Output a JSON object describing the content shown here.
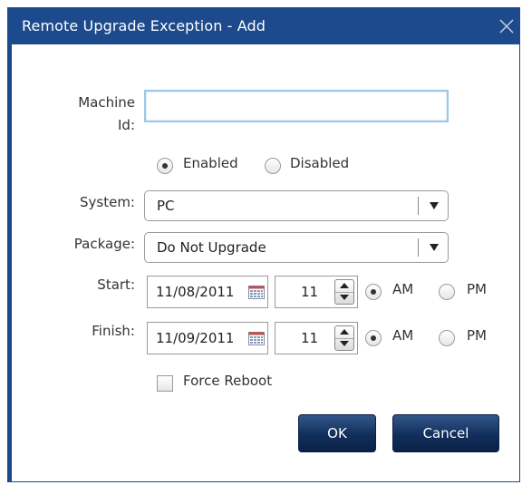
{
  "dialog": {
    "title": "Remote Upgrade Exception - Add",
    "close_glyph": "✕"
  },
  "form": {
    "machine_id": {
      "label_line1": "Machine",
      "label_line2": "Id:",
      "value": ""
    },
    "status": {
      "options": [
        "Enabled",
        "Disabled"
      ],
      "selected": "Enabled"
    },
    "system": {
      "label": "System:",
      "value": "PC"
    },
    "package": {
      "label": "Package:",
      "value": "Do Not Upgrade"
    },
    "start": {
      "label": "Start:",
      "date": "11/08/2011",
      "hour": "11",
      "am_label": "AM",
      "pm_label": "PM",
      "period": "AM"
    },
    "finish": {
      "label": "Finish:",
      "date": "11/09/2011",
      "hour": "11",
      "am_label": "AM",
      "pm_label": "PM",
      "period": "AM"
    },
    "force_reboot": {
      "label": "Force Reboot",
      "checked": false
    }
  },
  "buttons": {
    "ok": "OK",
    "cancel": "Cancel"
  },
  "colors": {
    "titlebar": "#1d4a8c",
    "button_dark": "#112e5c",
    "focus_border": "#9cc7e6"
  },
  "icons": {
    "close": "close-icon",
    "calendar": "calendar-icon",
    "dropdown": "chevron-down-icon",
    "spin_up": "spin-up-icon",
    "spin_down": "spin-down-icon"
  }
}
